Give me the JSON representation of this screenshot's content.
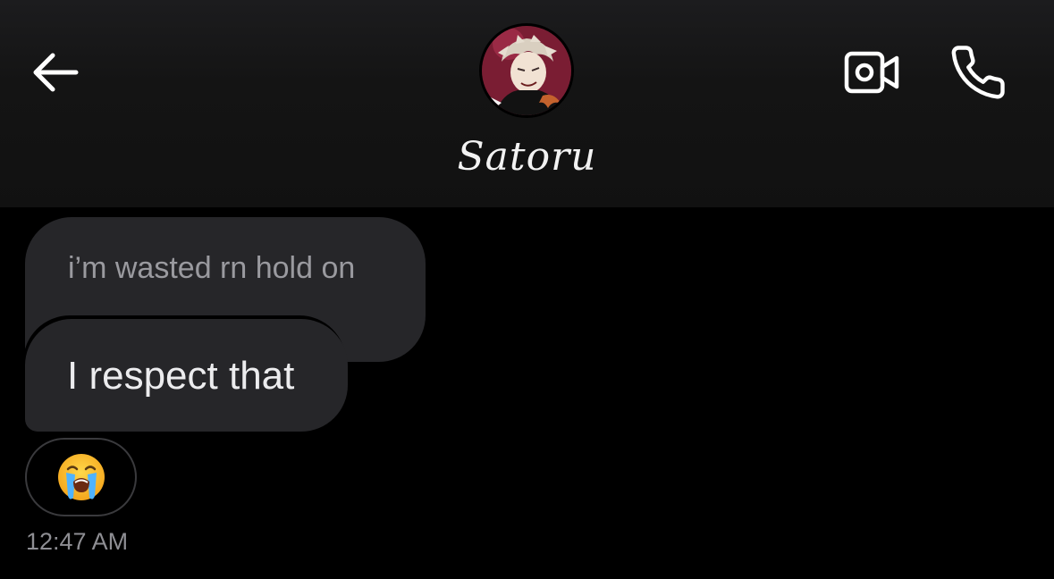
{
  "header": {
    "contact_name": "Satoru",
    "back_icon": "arrow-left-icon",
    "video_icon": "video-camera-icon",
    "call_icon": "phone-icon"
  },
  "messages": [
    {
      "text": "i’m wasted rn hold on",
      "style": "dimmed"
    },
    {
      "text": "I respect that",
      "style": "normal"
    }
  ],
  "reaction": {
    "emoji": "😭",
    "icon": "crying-face-icon"
  },
  "timestamp": "12:47 AM",
  "colors": {
    "background": "#000000",
    "header": "#141414",
    "bubble": "#262629",
    "dim_text": "#9a9a9f",
    "text": "#ececee",
    "timestamp": "#8e8e93"
  }
}
